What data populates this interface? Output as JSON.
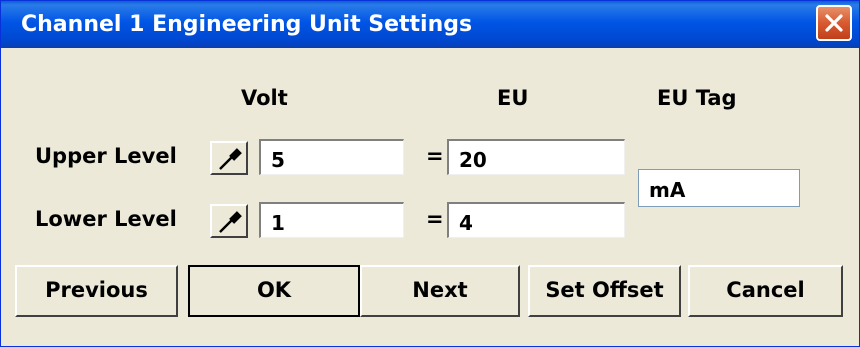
{
  "window": {
    "title": "Channel 1 Engineering Unit Settings"
  },
  "headers": {
    "volt": "Volt",
    "eu": "EU",
    "eu_tag": "EU Tag"
  },
  "rows": {
    "upper": {
      "label": "Upper Level",
      "volt_value": "5",
      "equals": "=",
      "eu_value": "20"
    },
    "lower": {
      "label": "Lower Level",
      "volt_value": "1",
      "equals": "=",
      "eu_value": "4"
    }
  },
  "eu_tag_value": "mA",
  "buttons": {
    "previous": "Previous",
    "ok": "OK",
    "next": "Next",
    "set_offset": "Set Offset",
    "cancel": "Cancel"
  },
  "icons": {
    "close": "close-icon",
    "picker": "eyedropper-icon"
  }
}
